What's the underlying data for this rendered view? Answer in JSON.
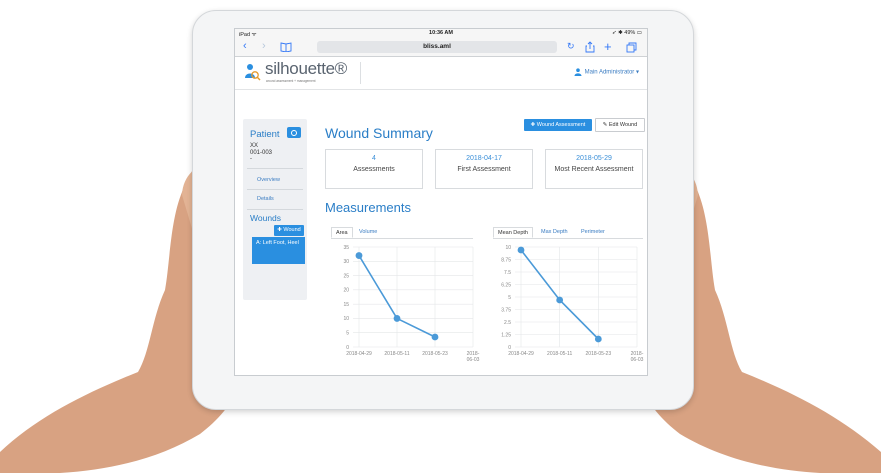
{
  "statusbar": {
    "left": "iPad ᯤ",
    "time": "10:36 AM",
    "right": "➶ ✱ 49% ▭"
  },
  "browser": {
    "url": "bliss.aml",
    "icons": {
      "back": "chevron-left-icon",
      "forward": "chevron-right-icon",
      "bookmarks": "book-icon",
      "reload": "reload-icon",
      "share": "share-icon",
      "new_tab": "plus-icon",
      "tabs": "tabs-icon"
    }
  },
  "app": {
    "logo": "silhouette®",
    "logo_tagline": "wound assessment + management",
    "user": "Main Administrator ▾"
  },
  "sidebar": {
    "patient_label": "Patient",
    "patient_name": "XX",
    "patient_id": "001-003",
    "patient_extra": "-",
    "links": [
      "Overview",
      "Details"
    ],
    "wounds_label": "Wounds",
    "add_wound": "✚ Wound",
    "wound_item": "A: Left Foot, Heel"
  },
  "main": {
    "title": "Wound Summary",
    "btn_assessment": "✚ Wound Assessment",
    "btn_edit": "✎ Edit Wound",
    "stats": [
      {
        "value": "4",
        "label": "Assessments"
      },
      {
        "value": "2018-04-17",
        "label": "First Assessment"
      },
      {
        "value": "2018-05-29",
        "label": "Most Recent Assessment"
      }
    ],
    "measurements_title": "Measurements",
    "left_tabs": [
      "Area",
      "Volume"
    ],
    "right_tabs": [
      "Mean Depth",
      "Max Depth",
      "Perimeter"
    ]
  },
  "colors": {
    "accent": "#2a8fe0",
    "link": "#3a7cc2",
    "line": "#4b9ad8"
  },
  "chart_data": [
    {
      "type": "line",
      "name": "Area",
      "x": [
        "2018-04-29",
        "2018-05-11",
        "2018-05-23",
        "2018-06-03"
      ],
      "y_ticks": [
        "35",
        "30",
        "25",
        "20",
        "15",
        "10",
        "5",
        "0"
      ],
      "ylim": [
        0,
        35
      ],
      "series": [
        {
          "values": [
            32,
            10,
            3.5,
            null
          ]
        }
      ],
      "grid": true
    },
    {
      "type": "line",
      "name": "Mean Depth",
      "x": [
        "2018-04-29",
        "2018-05-11",
        "2018-05-23",
        "2018-06-03"
      ],
      "y_ticks": [
        "10",
        "8.75",
        "7.5",
        "6.25",
        "5",
        "3.75",
        "2.5",
        "1.25",
        "0"
      ],
      "ylim": [
        0,
        10
      ],
      "series": [
        {
          "values": [
            9.7,
            4.7,
            0.8,
            null
          ]
        }
      ],
      "grid": true
    }
  ]
}
